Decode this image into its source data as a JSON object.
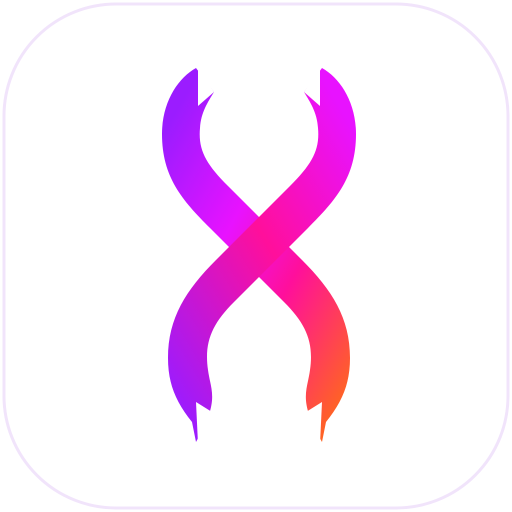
{
  "icon": {
    "name": "twisted-ribbon-logo",
    "tile_border_color": "#f1e4fb",
    "tile_fill_color": "#ffffff",
    "gradient_colors": [
      "#9b1cff",
      "#e812ff",
      "#ff0f9b",
      "#ff6a1a"
    ]
  }
}
